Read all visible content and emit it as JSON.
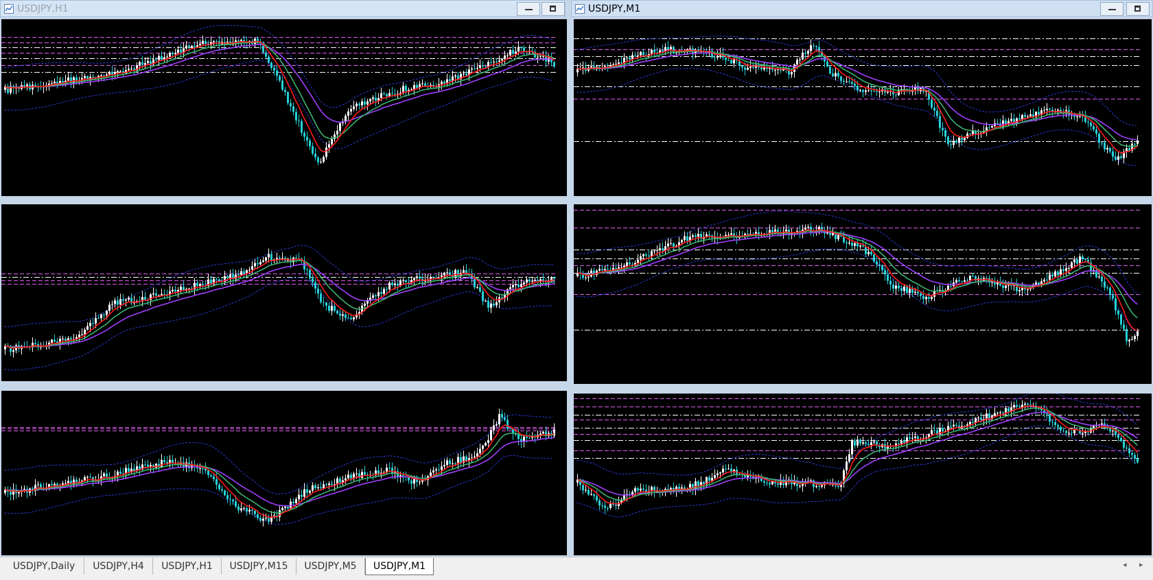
{
  "windows": [
    {
      "title": "USDJPY,H1",
      "active": false
    },
    {
      "title": "USDJPY,M1",
      "active": true
    }
  ],
  "tabs": [
    {
      "label": "USDJPY,Daily",
      "active": false
    },
    {
      "label": "USDJPY,H4",
      "active": false
    },
    {
      "label": "USDJPY,H1",
      "active": false
    },
    {
      "label": "USDJPY,M15",
      "active": false
    },
    {
      "label": "USDJPY,M5",
      "active": false
    },
    {
      "label": "USDJPY,M1",
      "active": true
    }
  ],
  "tab_scroll": {
    "left": "◂",
    "right": "▸"
  },
  "colors": {
    "chart_bg": "#000000",
    "bull_candle": "#ffffff",
    "bear_candle": "#26d1d8",
    "ma_fast": "#ff1a1a",
    "ma_mid": "#3cb371",
    "ma_slow": "#a040ff",
    "bollinger": "#2b3bd6",
    "level_magenta": "#e060f0",
    "level_white": "#ffffff"
  },
  "icons": {
    "chart_window": "chart-window-icon",
    "minimize": "minimize-icon",
    "maximize": "maximize-icon"
  },
  "chart_panels": [
    {
      "name": "top-left",
      "shape": [
        [
          0,
          40
        ],
        [
          0.2,
          31
        ],
        [
          0.35,
          14
        ],
        [
          0.46,
          12
        ],
        [
          0.5,
          36
        ],
        [
          0.57,
          82
        ],
        [
          0.63,
          50
        ],
        [
          0.68,
          44
        ],
        [
          0.74,
          38
        ],
        [
          0.8,
          36
        ],
        [
          0.88,
          25
        ],
        [
          0.94,
          16
        ],
        [
          1,
          25
        ]
      ],
      "levels": [
        {
          "y": 0.1,
          "c": "m"
        },
        {
          "y": 0.13,
          "c": "m"
        },
        {
          "y": 0.16,
          "c": "w"
        },
        {
          "y": 0.19,
          "c": "m"
        },
        {
          "y": 0.22,
          "c": "w"
        },
        {
          "y": 0.26,
          "c": "m"
        },
        {
          "y": 0.3,
          "c": "w"
        }
      ]
    },
    {
      "name": "top-right",
      "shape": [
        [
          0,
          30
        ],
        [
          0.15,
          17
        ],
        [
          0.25,
          20
        ],
        [
          0.3,
          27
        ],
        [
          0.38,
          30
        ],
        [
          0.42,
          13
        ],
        [
          0.45,
          30
        ],
        [
          0.52,
          42
        ],
        [
          0.62,
          40
        ],
        [
          0.66,
          70
        ],
        [
          0.72,
          63
        ],
        [
          0.82,
          53
        ],
        [
          0.86,
          51
        ],
        [
          0.9,
          55
        ],
        [
          0.96,
          80
        ],
        [
          1,
          68
        ]
      ],
      "levels": [
        {
          "y": 0.11,
          "c": "w"
        },
        {
          "y": 0.17,
          "c": "m"
        },
        {
          "y": 0.21,
          "c": "w"
        },
        {
          "y": 0.26,
          "c": "w"
        },
        {
          "y": 0.38,
          "c": "w"
        },
        {
          "y": 0.45,
          "c": "m"
        },
        {
          "y": 0.69,
          "c": "w"
        }
      ]
    },
    {
      "name": "middle-left",
      "shape": [
        [
          0,
          82
        ],
        [
          0.12,
          77
        ],
        [
          0.2,
          56
        ],
        [
          0.3,
          50
        ],
        [
          0.42,
          40
        ],
        [
          0.48,
          30
        ],
        [
          0.54,
          32
        ],
        [
          0.58,
          57
        ],
        [
          0.63,
          64
        ],
        [
          0.7,
          45
        ],
        [
          0.8,
          40
        ],
        [
          0.84,
          38
        ],
        [
          0.88,
          58
        ],
        [
          0.93,
          45
        ],
        [
          1,
          42
        ]
      ],
      "levels": [
        {
          "y": 0.39,
          "c": "m"
        },
        {
          "y": 0.41,
          "c": "w"
        },
        {
          "y": 0.43,
          "c": "m"
        },
        {
          "y": 0.45,
          "c": "m"
        }
      ]
    },
    {
      "name": "middle-right",
      "shape": [
        [
          0,
          40
        ],
        [
          0.1,
          32
        ],
        [
          0.2,
          18
        ],
        [
          0.35,
          16
        ],
        [
          0.43,
          14
        ],
        [
          0.48,
          20
        ],
        [
          0.52,
          27
        ],
        [
          0.56,
          45
        ],
        [
          0.62,
          52
        ],
        [
          0.7,
          40
        ],
        [
          0.8,
          48
        ],
        [
          0.83,
          43
        ],
        [
          0.9,
          30
        ],
        [
          0.95,
          48
        ],
        [
          0.98,
          75
        ],
        [
          1,
          72
        ]
      ],
      "levels": [
        {
          "y": 0.03,
          "c": "m"
        },
        {
          "y": 0.13,
          "c": "m"
        },
        {
          "y": 0.25,
          "c": "w"
        },
        {
          "y": 0.3,
          "c": "w"
        },
        {
          "y": 0.34,
          "c": "m"
        },
        {
          "y": 0.38,
          "c": "w"
        },
        {
          "y": 0.5,
          "c": "m"
        },
        {
          "y": 0.7,
          "c": "w"
        }
      ]
    },
    {
      "name": "bottom-left",
      "shape": [
        [
          0,
          62
        ],
        [
          0.15,
          54
        ],
        [
          0.3,
          43
        ],
        [
          0.36,
          48
        ],
        [
          0.42,
          70
        ],
        [
          0.48,
          80
        ],
        [
          0.55,
          60
        ],
        [
          0.63,
          52
        ],
        [
          0.7,
          48
        ],
        [
          0.75,
          56
        ],
        [
          0.8,
          44
        ],
        [
          0.86,
          40
        ],
        [
          0.9,
          16
        ],
        [
          0.94,
          30
        ],
        [
          1,
          25
        ]
      ],
      "levels": [
        {
          "y": 0.22,
          "c": "m"
        },
        {
          "y": 0.23,
          "c": "m"
        },
        {
          "y": 0.24,
          "c": "m"
        }
      ]
    },
    {
      "name": "bottom-right",
      "shape": [
        [
          0,
          55
        ],
        [
          0.05,
          72
        ],
        [
          0.1,
          60
        ],
        [
          0.2,
          58
        ],
        [
          0.27,
          47
        ],
        [
          0.35,
          55
        ],
        [
          0.47,
          56
        ],
        [
          0.49,
          30
        ],
        [
          0.55,
          32
        ],
        [
          0.62,
          26
        ],
        [
          0.7,
          18
        ],
        [
          0.78,
          8
        ],
        [
          0.82,
          7
        ],
        [
          0.86,
          22
        ],
        [
          0.9,
          24
        ],
        [
          0.94,
          18
        ],
        [
          1,
          42
        ]
      ],
      "levels": [
        {
          "y": 0.03,
          "c": "m"
        },
        {
          "y": 0.08,
          "c": "m"
        },
        {
          "y": 0.13,
          "c": "w"
        },
        {
          "y": 0.16,
          "c": "m"
        },
        {
          "y": 0.21,
          "c": "w"
        },
        {
          "y": 0.25,
          "c": "m"
        },
        {
          "y": 0.29,
          "c": "w"
        },
        {
          "y": 0.35,
          "c": "m"
        },
        {
          "y": 0.4,
          "c": "w"
        }
      ]
    }
  ]
}
